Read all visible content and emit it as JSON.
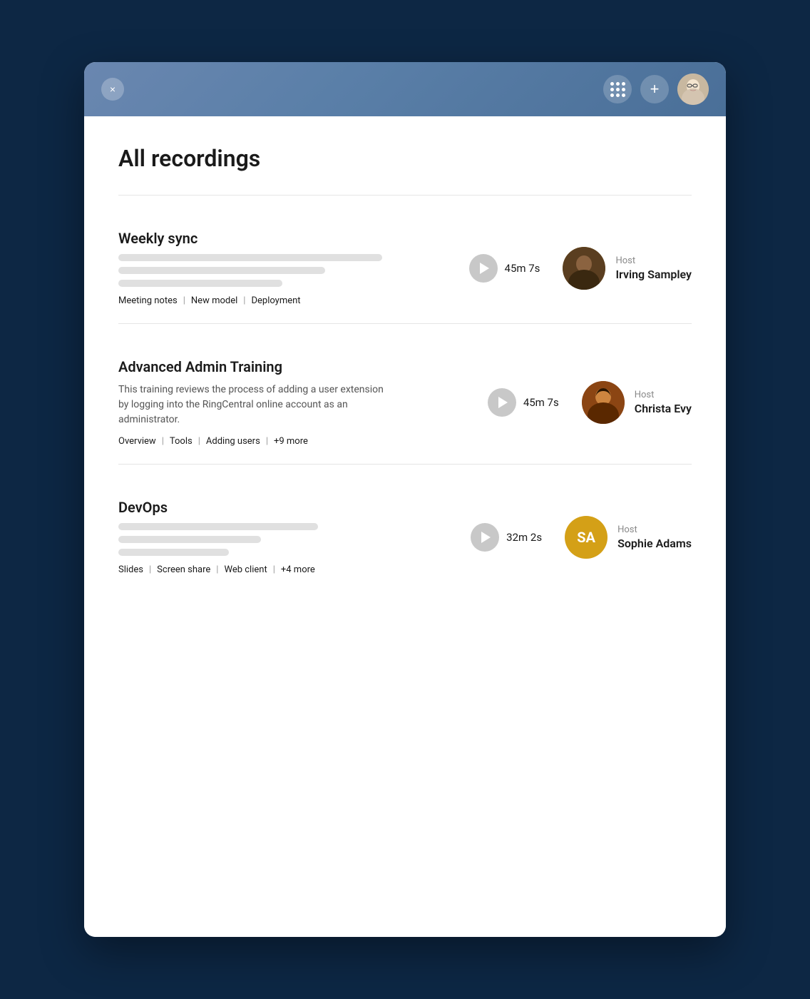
{
  "page": {
    "title": "All recordings"
  },
  "header": {
    "close_label": "×",
    "grid_icon": "grid-icon",
    "plus_icon": "+",
    "user_avatar_alt": "User avatar"
  },
  "recordings": [
    {
      "id": "weekly-sync",
      "title": "Weekly sync",
      "description": null,
      "has_skeleton": true,
      "skeleton_widths": [
        "370px",
        "290px",
        "230px"
      ],
      "duration": "45m 7s",
      "host_label": "Host",
      "host_name": "Irving Sampley",
      "host_avatar_type": "image",
      "host_avatar_color": null,
      "host_initials": null,
      "tags": [
        "Meeting notes",
        "New model",
        "Deployment"
      ],
      "tags_separator": "|"
    },
    {
      "id": "advanced-admin-training",
      "title": "Advanced Admin Training",
      "description": "This training reviews the process of adding a user extension by logging into the RingCentral online account as an administrator.",
      "has_skeleton": false,
      "skeleton_widths": [],
      "duration": "45m 7s",
      "host_label": "Host",
      "host_name": "Christa Evy",
      "host_avatar_type": "image",
      "host_avatar_color": null,
      "host_initials": null,
      "tags": [
        "Overview",
        "Tools",
        "Adding users",
        "+9 more"
      ],
      "tags_separator": "|"
    },
    {
      "id": "devops",
      "title": "DevOps",
      "description": null,
      "has_skeleton": true,
      "skeleton_widths": [
        "280px",
        "200px",
        "155px"
      ],
      "duration": "32m 2s",
      "host_label": "Host",
      "host_name": "Sophie Adams",
      "host_avatar_type": "initials",
      "host_avatar_color": "#D4A017",
      "host_initials": "SA",
      "tags": [
        "Slides",
        "Screen share",
        "Web client",
        "+4 more"
      ],
      "tags_separator": "|"
    }
  ]
}
